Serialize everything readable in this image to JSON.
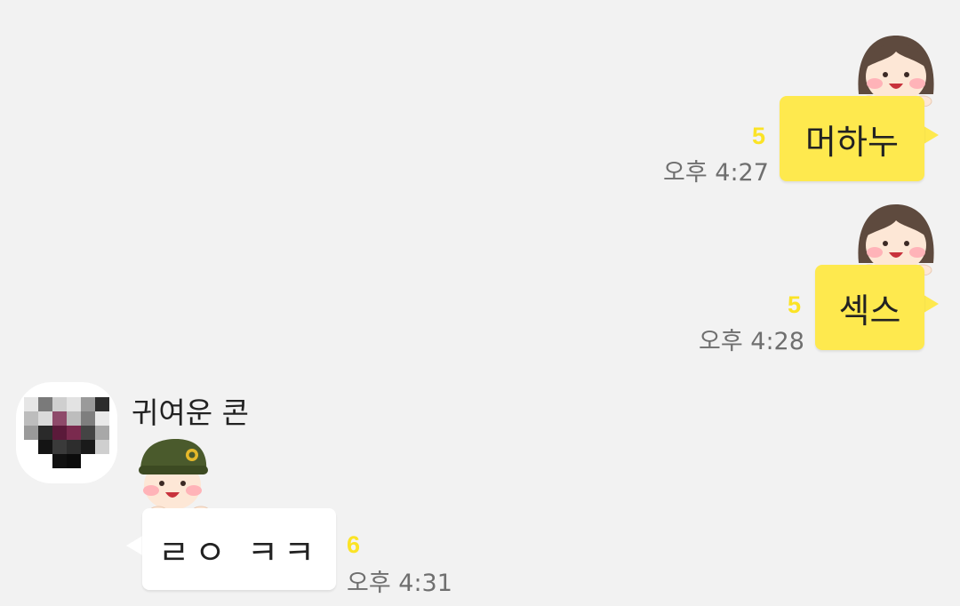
{
  "messages": [
    {
      "direction": "outgoing",
      "text": "머하누",
      "unread_count": "5",
      "time": "오후 4:27",
      "emoticon": "girl-character-icon"
    },
    {
      "direction": "outgoing",
      "text": "섹스",
      "unread_count": "5",
      "time": "오후 4:28",
      "emoticon": "girl-character-icon"
    },
    {
      "direction": "incoming",
      "sender": "귀여운 콘",
      "text": "ㄹㅇ ㅋㅋ",
      "unread_count": "6",
      "time": "오후 4:31",
      "emoticon": "soldier-character-icon",
      "avatar": "pixelated-avatar"
    }
  ],
  "colors": {
    "background": "#f2f2f2",
    "outgoing_bubble": "#fee94e",
    "incoming_bubble": "#ffffff",
    "unread_count": "#fbe326",
    "time_text": "#6f6f6f"
  }
}
